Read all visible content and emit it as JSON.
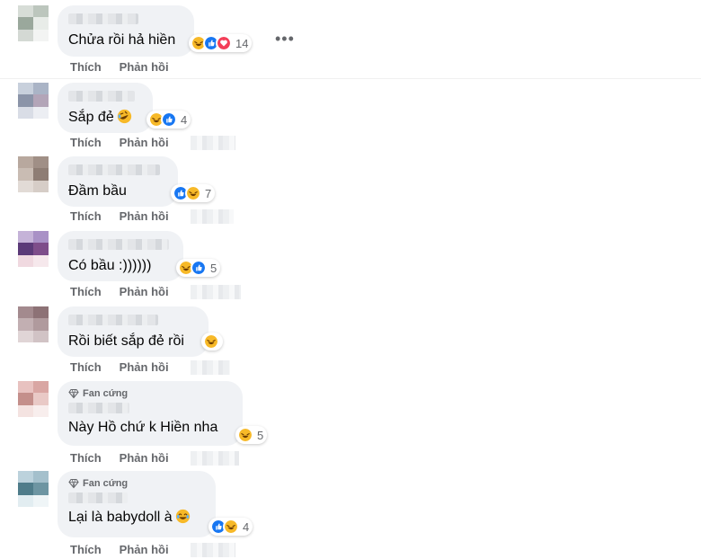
{
  "comments": [
    {
      "text": "Chửa rồi hả hiền",
      "name_blur": true,
      "badge": "",
      "reactions": [
        "haha",
        "like",
        "love"
      ],
      "count": "14",
      "actions": {
        "like": "Thích",
        "reply": "Phản hồi"
      }
    },
    {
      "text": "Sắp đẻ",
      "inline_emoji": "rofl",
      "badge": "",
      "reactions": [
        "haha",
        "like"
      ],
      "count": "4",
      "actions": {
        "like": "Thích",
        "reply": "Phản hồi"
      }
    },
    {
      "text": "Đầm bầu",
      "badge": "",
      "reactions": [
        "like",
        "haha"
      ],
      "count": "7",
      "actions": {
        "like": "Thích",
        "reply": "Phản hồi"
      }
    },
    {
      "text": "Có bầu :))))))",
      "badge": "",
      "reactions": [
        "haha",
        "like"
      ],
      "count": "5",
      "actions": {
        "like": "Thích",
        "reply": "Phản hồi"
      }
    },
    {
      "text": "Rồi biết sắp đẻ rồi",
      "badge": "",
      "reactions": [
        "haha"
      ],
      "count": "",
      "actions": {
        "like": "Thích",
        "reply": "Phản hồi"
      }
    },
    {
      "text": "Này Hồ chứ k Hiền nha",
      "badge": "Fan cứng",
      "reactions": [
        "haha"
      ],
      "count": "5",
      "actions": {
        "like": "Thích",
        "reply": "Phản hồi"
      }
    },
    {
      "text": "Lại là babydoll à",
      "inline_emoji": "laugh-tears",
      "badge": "Fan cứng",
      "reactions": [
        "like",
        "haha"
      ],
      "count": "4",
      "actions": {
        "like": "Thích",
        "reply": "Phản hồi"
      }
    }
  ],
  "more_icon": "more-horizontal-icon",
  "colors": {
    "like": "#1877f2",
    "haha": "#f7b928",
    "love": "#f33e58",
    "bubble": "#f0f2f5",
    "muted": "#65676b"
  }
}
